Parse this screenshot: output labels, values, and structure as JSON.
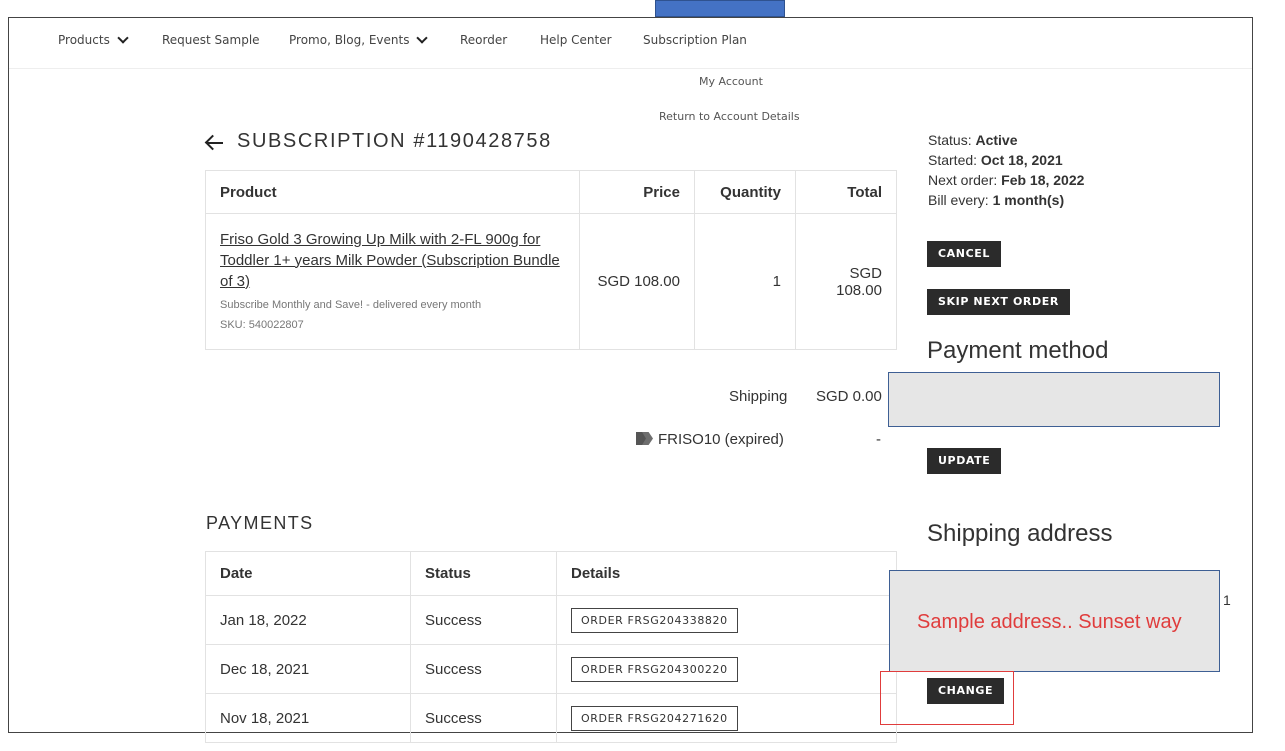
{
  "nav": {
    "items": [
      {
        "label": "Products",
        "dropdown": true
      },
      {
        "label": "Request Sample",
        "dropdown": false
      },
      {
        "label": "Promo, Blog, Events",
        "dropdown": true
      },
      {
        "label": "Reorder",
        "dropdown": false
      },
      {
        "label": "Help Center",
        "dropdown": false
      },
      {
        "label": "Subscription Plan",
        "dropdown": false
      }
    ]
  },
  "account_links": {
    "my_account": "My Account",
    "return": "Return to Account Details"
  },
  "subscription": {
    "title": "SUBSCRIPTION #1190428758"
  },
  "product_table": {
    "headers": {
      "product": "Product",
      "price": "Price",
      "quantity": "Quantity",
      "total": "Total"
    },
    "row": {
      "name": "Friso Gold 3 Growing Up Milk with 2-FL 900g for Toddler 1+ years Milk Powder (Subscription Bundle of 3)",
      "plan": "Subscribe Monthly and Save! - delivered every month",
      "sku": "SKU: 540022807",
      "price": "SGD 108.00",
      "quantity": "1",
      "total": "SGD 108.00"
    }
  },
  "shipping": {
    "label": "Shipping",
    "value": "SGD 0.00"
  },
  "coupon": {
    "code": "FRISO10 (expired)",
    "value": "-"
  },
  "payments": {
    "title": "PAYMENTS",
    "headers": {
      "date": "Date",
      "status": "Status",
      "details": "Details"
    },
    "rows": [
      {
        "date": "Jan 18, 2022",
        "status": "Success",
        "order": "ORDER FRSG204338820"
      },
      {
        "date": "Dec 18, 2021",
        "status": "Success",
        "order": "ORDER FRSG204300220"
      },
      {
        "date": "Nov 18, 2021",
        "status": "Success",
        "order": "ORDER FRSG204271620"
      }
    ]
  },
  "sidebar": {
    "status_label": "Status:",
    "status_value": "Active",
    "started_label": "Started:",
    "started_value": "Oct 18, 2021",
    "next_label": "Next order:",
    "next_value": "Feb 18, 2022",
    "bill_label": "Bill every:",
    "bill_value": "1 month(s)",
    "cancel_label": "CANCEL",
    "skip_label": "SKIP NEXT ORDER",
    "payment_heading": "Payment method",
    "update_label": "UPDATE",
    "shipping_heading": "Shipping address",
    "address_text": "Sample address.. Sunset way",
    "address_overflow": "1",
    "change_label": "CHANGE"
  },
  "colors": {
    "highlight_box": "#e6e6e6",
    "box_border": "#3e5f94",
    "annotation_red": "#e03c3c",
    "top_tab": "#4472c4",
    "button_dark": "#2b2b2b"
  }
}
